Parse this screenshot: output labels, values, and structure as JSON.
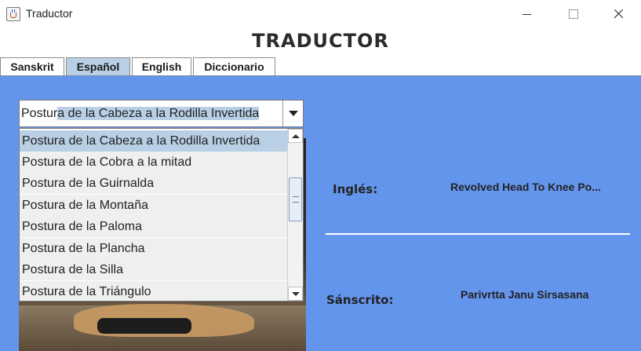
{
  "window": {
    "title": "Traductor"
  },
  "app": {
    "heading": "TRADUCTOR"
  },
  "tabs": [
    {
      "label": "Sanskrit",
      "active": false
    },
    {
      "label": "Español",
      "active": true
    },
    {
      "label": "English",
      "active": false
    },
    {
      "label": "Diccionario",
      "active": false
    }
  ],
  "combo": {
    "value_prefix": "Postur",
    "value_selected": "a de la Cabeza a la Rodilla Invertida"
  },
  "dropdown": {
    "options": [
      "Postura de la Cabeza a la Rodilla Invertida",
      "Postura de la Cobra a la mitad",
      "Postura de la Guirnalda",
      "Postura de la Montaña",
      "Postura de la Paloma",
      "Postura de la Plancha",
      "Postura de la Silla",
      "Postura de la Triángulo"
    ],
    "selected_index": 0
  },
  "translation": {
    "english_label": "Inglés:",
    "english_value": "Revolved Head To Knee Po...",
    "sanskrit_label": "Sánscrito:",
    "sanskrit_value": "Parivrtta Janu Sirsasana"
  },
  "colors": {
    "panel_bg": "#6495ed",
    "selection": "#b8cfe5"
  }
}
